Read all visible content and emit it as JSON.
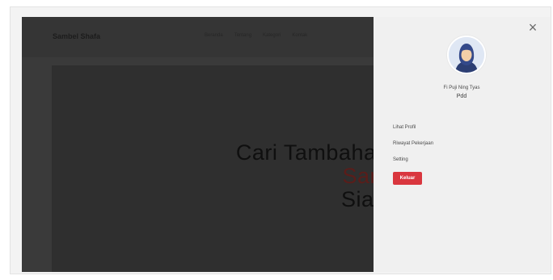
{
  "navbar": {
    "brand": "Sambel Shafa",
    "links": [
      "Beranda",
      "Tentang",
      "Kategori",
      "Kontak"
    ]
  },
  "hero": {
    "line1": "Cari Tambahan U",
    "line2": "Sambil",
    "line3": "Siap M"
  },
  "drawer": {
    "close_icon": "×",
    "user_name": "Fi Puji Ning Tyas",
    "user_role": "Pdd",
    "menu": [
      "Lihat Profil",
      "Riwayat Pekerjaan",
      "Setting"
    ],
    "logout_label": "Keluar"
  },
  "colors": {
    "overlay": "#3a3a3a",
    "drawer_bg": "#f0f0f0",
    "logout_button": "#d9363e",
    "hero_accent": "#5a1d1a"
  }
}
